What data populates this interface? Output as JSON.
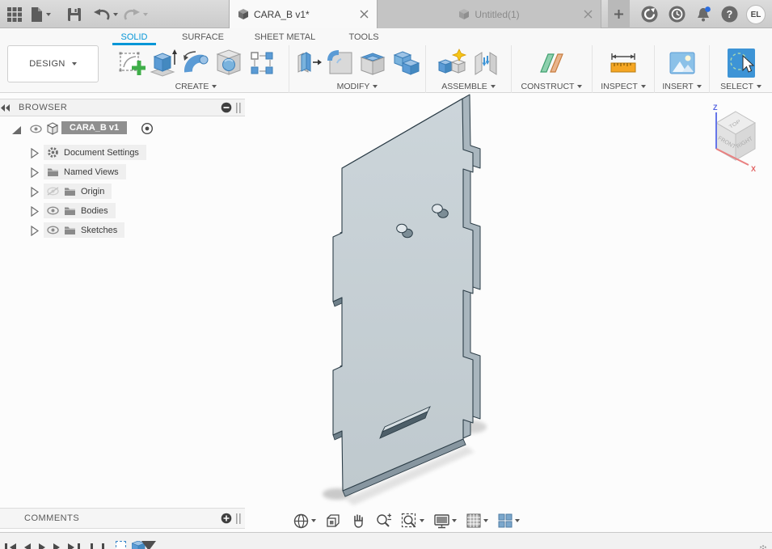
{
  "titlebar": {
    "document_tabs": [
      {
        "label": "CARA_B v1*",
        "active": true
      },
      {
        "label": "Untitled(1)",
        "active": false
      }
    ],
    "avatar_label": "EL"
  },
  "ribbon": {
    "design_menu": "DESIGN",
    "tabs": [
      {
        "label": "SOLID",
        "active": true
      },
      {
        "label": "SURFACE",
        "active": false
      },
      {
        "label": "SHEET METAL",
        "active": false
      },
      {
        "label": "TOOLS",
        "active": false
      }
    ],
    "groups": [
      {
        "label": "CREATE"
      },
      {
        "label": "MODIFY"
      },
      {
        "label": "ASSEMBLE"
      },
      {
        "label": "CONSTRUCT"
      },
      {
        "label": "INSPECT"
      },
      {
        "label": "INSERT"
      },
      {
        "label": "SELECT"
      }
    ]
  },
  "browser": {
    "title": "BROWSER",
    "root": {
      "label": "CARA_B v1"
    },
    "items": [
      {
        "label": "Document Settings",
        "icon": "gear-icon",
        "visibility": "none"
      },
      {
        "label": "Named Views",
        "icon": "folder-icon",
        "visibility": "none"
      },
      {
        "label": "Origin",
        "icon": "folder-icon",
        "visibility": "hidden"
      },
      {
        "label": "Bodies",
        "icon": "folder-icon",
        "visibility": "visible"
      },
      {
        "label": "Sketches",
        "icon": "folder-icon",
        "visibility": "visible"
      }
    ]
  },
  "comments_panel": {
    "title": "COMMENTS"
  },
  "viewcube": {
    "top": "TOP",
    "front": "FRONT",
    "right": "RIGHT",
    "axis_z": "Z",
    "axis_x": "X"
  },
  "icons": {
    "help_glyph": "?"
  },
  "colors": {
    "accent_blue": "#0696d7",
    "icon_blue": "#5b9bd5",
    "model_face": "#c9d2d7",
    "model_edge": "#2d3e48",
    "selection_gray": "#8f8f8f",
    "notification_dot": "#2a6de0",
    "axis_z_blue": "#5f6fe8",
    "axis_x_red": "#e05a5a"
  }
}
